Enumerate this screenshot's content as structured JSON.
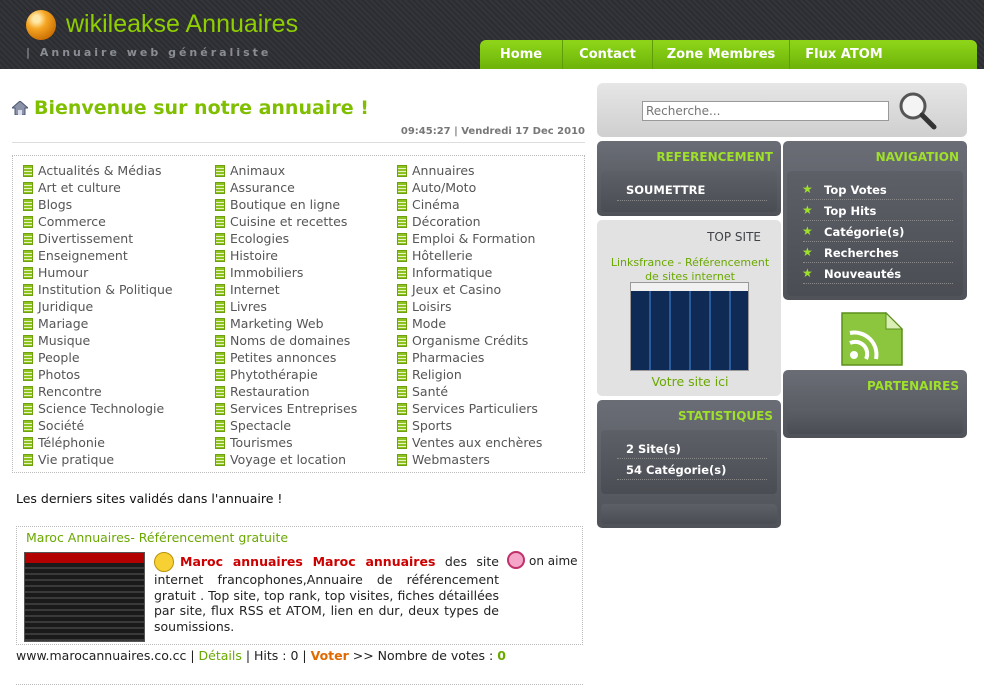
{
  "header": {
    "title": "wikileakse Annuaires",
    "subtitle": "| Annuaire web généraliste",
    "nav": [
      "Home",
      "Contact",
      "Zone Membres",
      "Flux ATOM"
    ]
  },
  "main": {
    "welcome": "Bienvenue sur notre annuaire !",
    "datetime": "09:45:27 | Vendredi 17 Dec 2010",
    "categories": [
      [
        "Actualités & Médias",
        "Art et culture",
        "Blogs",
        "Commerce",
        "Divertissement",
        "Enseignement",
        "Humour",
        "Institution & Politique",
        "Juridique",
        "Mariage",
        "Musique",
        "People",
        "Photos",
        "Rencontre",
        "Science Technologie",
        "Société",
        "Téléphonie",
        "Vie pratique"
      ],
      [
        "Animaux",
        "Assurance",
        "Boutique en ligne",
        "Cuisine et recettes",
        "Ecologies",
        "Histoire",
        "Immobiliers",
        "Internet",
        "Livres",
        "Marketing Web",
        "Noms de domaines",
        "Petites annonces",
        "Phytothérapie",
        "Restauration",
        "Services Entreprises",
        "Spectacle",
        "Tourismes",
        "Voyage et location"
      ],
      [
        "Annuaires",
        "Auto/Moto",
        "Cinéma",
        "Décoration",
        "Emploi & Formation",
        "Hôtellerie",
        "Informatique",
        "Jeux et Casino",
        "Loisirs",
        "Mode",
        "Organisme Crédits",
        "Pharmacies",
        "Religion",
        "Santé",
        "Services Particuliers",
        "Sports",
        "Ventes aux enchères",
        "Webmasters"
      ]
    ],
    "latest_heading": "Les derniers sites validés dans l'annuaire !",
    "site": {
      "title": "Maroc Annuaires- Référencement gratuite",
      "desc_link": "Maroc annuaires Maroc annuaires",
      "desc_text": " des site internet francophones,Annuaire de référencement gratuit . Top site, top rank, top visites, fiches détaillées par site, flux RSS et ATOM, lien en dur, deux types de soumissions.",
      "on_aime": "on aime",
      "url": "www.marocannuaires.co.cc",
      "details": "Détails",
      "hits": " | Hits : 0 | ",
      "vote": "Voter",
      "votes_label": " >> Nombre de votes : ",
      "votes_count": "0"
    }
  },
  "sidebar": {
    "search_placeholder": "Recherche...",
    "referencement": {
      "title": "REFERENCEMENT",
      "link": "SOUMETTRE"
    },
    "navigation": {
      "title": "NAVIGATION",
      "links": [
        "Top Votes",
        "Top Hits",
        "Catégorie(s)",
        "Recherches",
        "Nouveautés"
      ]
    },
    "topsite": {
      "title": "TOP SITE",
      "name": "Linksfrance - Référencement de sites internet",
      "cta": "Votre site ici"
    },
    "partenaires": {
      "title": "PARTENAIRES"
    },
    "statistiques": {
      "title": "STATISTIQUES",
      "lines": [
        "2 Site(s)",
        "54 Catégorie(s)"
      ]
    }
  },
  "colors": {
    "accent_green": "#7fbf00",
    "nav_green": "#7ac211",
    "header_bg": "#2e3035",
    "panel_grey": "#5d6067"
  }
}
